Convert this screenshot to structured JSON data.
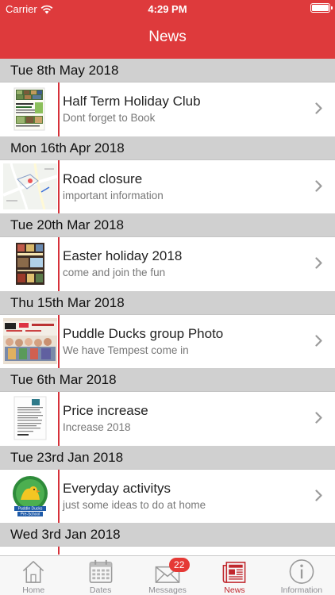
{
  "status_bar": {
    "carrier": "Carrier",
    "time": "4:29 PM"
  },
  "header": {
    "title": "News"
  },
  "sections": [
    {
      "date": "Tue 8th May 2018",
      "item": {
        "title": "Half Term Holiday Club",
        "subtitle": "Dont forget to Book",
        "thumbnail": "holiday-club-flyer"
      }
    },
    {
      "date": "Mon 16th Apr 2018",
      "item": {
        "title": "Road closure",
        "subtitle": "important information",
        "thumbnail": "map"
      }
    },
    {
      "date": "Tue 20th Mar 2018",
      "item": {
        "title": "Easter holiday 2018",
        "subtitle": "come and join the fun",
        "thumbnail": "easter-flyer"
      }
    },
    {
      "date": "Thu 15th Mar 2018",
      "item": {
        "title": "Puddle Ducks group Photo",
        "subtitle": "We have Tempest come in",
        "thumbnail": "group-photo"
      }
    },
    {
      "date": "Tue 6th Mar 2018",
      "item": {
        "title": "Price increase",
        "subtitle": "Increase 2018",
        "thumbnail": "letter"
      }
    },
    {
      "date": "Tue 23rd Jan 2018",
      "item": {
        "title": "Everyday activitys",
        "subtitle": "just some ideas to do at home",
        "thumbnail": "puddle-ducks-logo"
      }
    },
    {
      "date": "Wed 3rd Jan 2018"
    }
  ],
  "logo_text": {
    "top": "Puddle Ducks",
    "bottom": "Pre-School"
  },
  "tabs": [
    {
      "label": "Home",
      "icon": "house-icon"
    },
    {
      "label": "Dates",
      "icon": "calendar-icon"
    },
    {
      "label": "Messages",
      "icon": "envelope-icon",
      "badge": "22"
    },
    {
      "label": "News",
      "icon": "newspaper-icon",
      "active": true
    },
    {
      "label": "Information",
      "icon": "info-icon"
    }
  ],
  "colors": {
    "accent": "#de3a3c",
    "section_bg": "#d0d0d0",
    "divider": "#d6313a",
    "active_tab": "#c0272d"
  }
}
